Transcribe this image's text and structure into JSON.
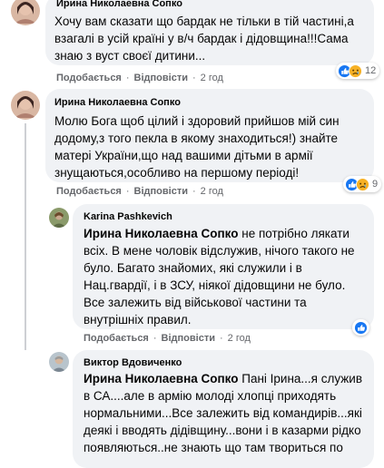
{
  "comments": [
    {
      "author": "Ирина Николаевна Сопко",
      "lines": [
        "Хочу вам сказати що бардак не тільки в тій частині,а",
        "взагалі в усій країні у в/ч бардак і дідовщина!!!Сама",
        "знаю з вуст своєї дитини..."
      ],
      "like_label": "Подобається",
      "reply_label": "Відповісти",
      "time": "2 год",
      "reaction_count": "12"
    },
    {
      "author": "Ирина Николаевна Сопко",
      "lines": [
        "Молю Бога щоб цілий і здоровий прийшов мій син",
        "додому,з того пекла в якому знаходиться!) знайте",
        "матері України,що над вашими дітьми в армії",
        "знущаються,особливо на першому періоді!"
      ],
      "like_label": "Подобається",
      "reply_label": "Відповісти",
      "time": "2 год",
      "reaction_count": "9"
    },
    {
      "author": "Karina Pashkevich",
      "mention": "Ирина Николаевна Сопко",
      "lines": [
        " не потрібно лякати",
        "всіх. В мене чоловік відслужив, нічого такого не",
        "було. Багато знайомих, які служили і в",
        "Нац.гвардії, і в ЗСУ, ніякої дідовщини не було.",
        "Все залежить від військової частини та",
        "внутрішніх правил."
      ],
      "like_label": "Подобається",
      "reply_label": "Відповісти",
      "time": "2 год",
      "reaction_count": ""
    },
    {
      "author": "Виктор Вдовиченко",
      "mention": "Ирина Николаевна Сопко",
      "lines": [
        " Пані Ірина...я служив",
        "в СА....але в армію молоді хлопці приходять",
        "нормальними...Все залежить від командирів...які",
        "деякі і вводять дідівщину...вони і в казарми рідко",
        "появляються..не знають що там твориться по"
      ]
    }
  ],
  "colors": {
    "bubble": "#f0f2f5",
    "meta": "#65676b",
    "like_blue": "#1877f2",
    "haha_yellow": "#f7b125"
  },
  "icons": [
    "like-icon",
    "haha-icon",
    "sad-icon"
  ]
}
